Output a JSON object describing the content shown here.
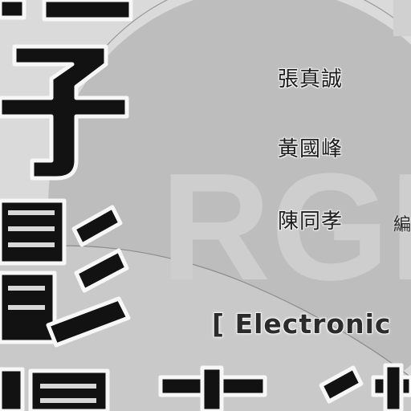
{
  "cover": {
    "authors": [
      "張真誠",
      "黃國峰",
      "陳同孝"
    ],
    "editor_mark": "編",
    "english_title": "[ Electronic",
    "watermark_text": "RGB",
    "title_chars": [
      "電",
      "子",
      "影",
      "像",
      "技",
      "術"
    ],
    "colors": {
      "background": "#dcdcdc",
      "disc": "#b9b9b9",
      "glyph_fill": "#111111",
      "glyph_outline": "#fafafa",
      "watermark": "#cfcfcf"
    }
  }
}
